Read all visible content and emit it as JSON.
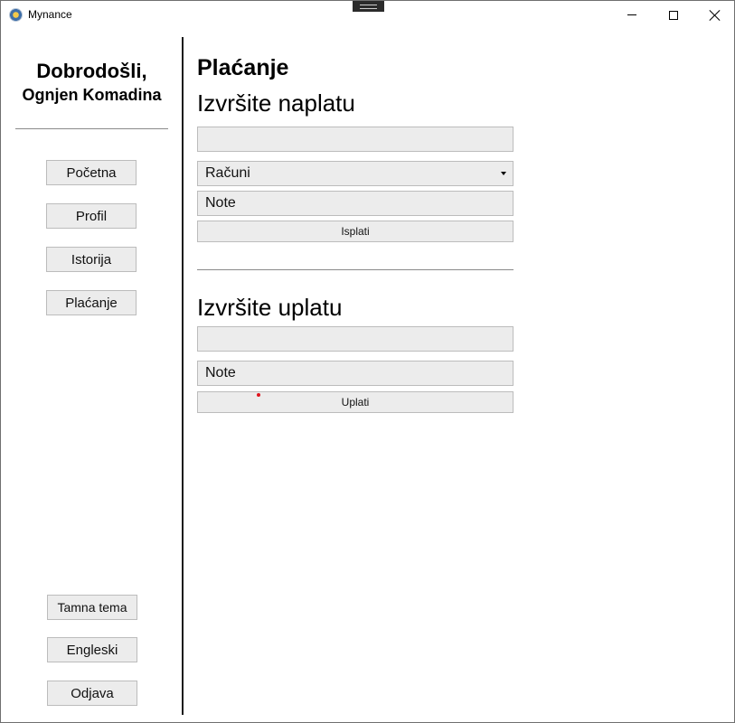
{
  "window": {
    "title": "Mynance",
    "icon": "mynance-app-icon"
  },
  "sidebar": {
    "welcome_line1": "Dobrodošli,",
    "welcome_line2": "Ognjen Komadina",
    "nav": [
      {
        "label": "Početna"
      },
      {
        "label": "Profil"
      },
      {
        "label": "Istorija"
      },
      {
        "label": "Plaćanje"
      }
    ],
    "bottom": {
      "theme_label": "Tamna tema",
      "language_label": "Engleski",
      "logout_label": "Odjava"
    }
  },
  "main": {
    "page_title": "Plaćanje",
    "payout": {
      "title": "Izvršite naplatu",
      "amount_value": "",
      "account_selected": "Računi",
      "note_value": "Note",
      "button_label": "Isplati"
    },
    "deposit": {
      "title": "Izvršite uplatu",
      "amount_value": "",
      "note_value": "Note",
      "button_label": "Uplati"
    }
  },
  "colors": {
    "control_bg": "#ececec",
    "control_border": "#bcbcbc",
    "divider": "#1a1a1a",
    "cursor_marker": "#e0141e"
  }
}
